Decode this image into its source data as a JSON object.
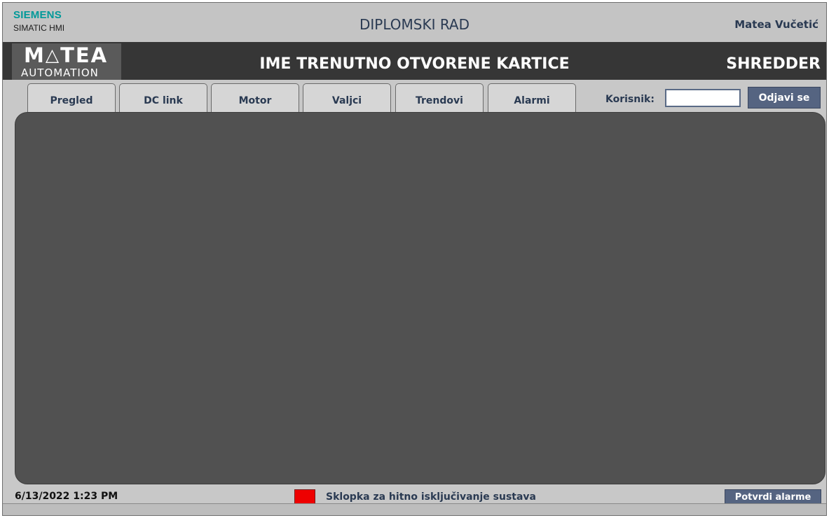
{
  "titlebar": {
    "brand": "SIEMENS",
    "product": "SIMATIC HMI",
    "title": "DIPLOMSKI RAD",
    "author": "Matea Vučetić"
  },
  "header": {
    "logo_main_left": "M",
    "logo_main_right": "TEA",
    "logo_sub": "AUTOMATION",
    "page_title": "IME TRENUTNO OTVORENE KARTICE",
    "machine": "SHREDDER"
  },
  "tabs": [
    {
      "label": "Pregled"
    },
    {
      "label": "DC link"
    },
    {
      "label": "Motor"
    },
    {
      "label": "Valjci"
    },
    {
      "label": "Trendovi"
    },
    {
      "label": "Alarmi"
    }
  ],
  "user": {
    "label": "Korisnik:",
    "value": "",
    "logout_label": "Odjavi se"
  },
  "footer": {
    "datetime": "6/13/2022 1:23 PM",
    "estop_label": "Sklopka za hitno isključivanje sustava",
    "estop_color": "#ee0000",
    "ack_label": "Potvrdi alarme"
  },
  "colors": {
    "accent": "#009999",
    "button": "#556481",
    "content_bg": "#515151"
  }
}
